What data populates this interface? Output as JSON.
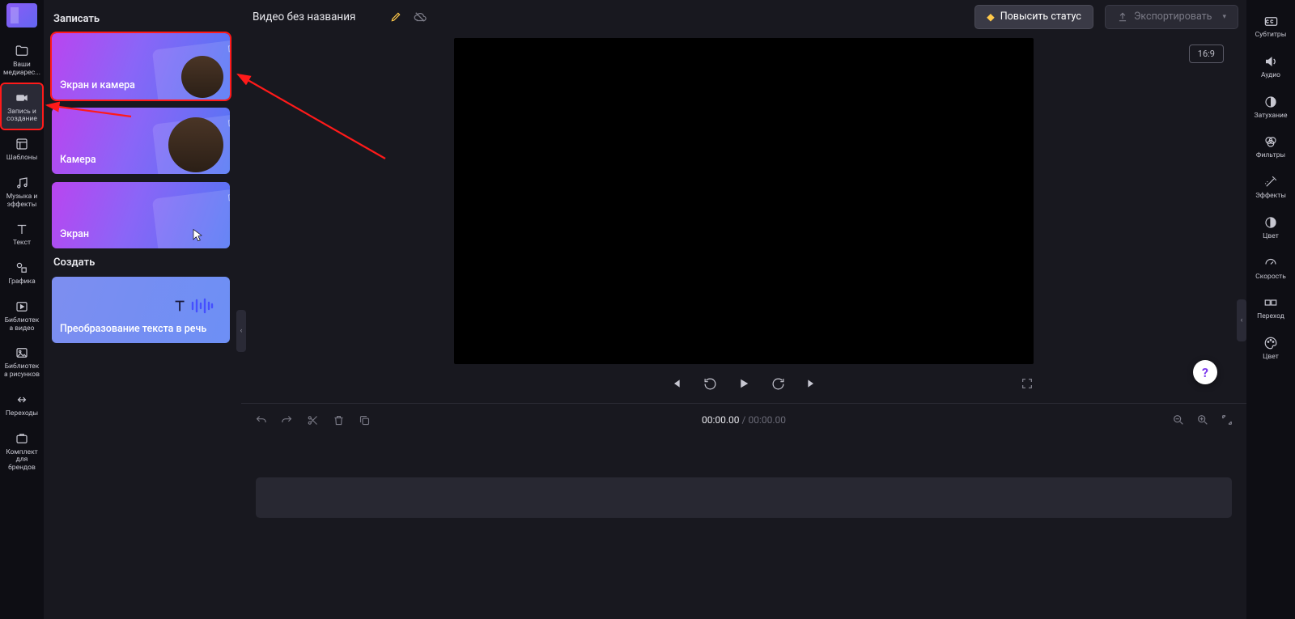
{
  "app": {
    "title": "Видео без названия"
  },
  "nav_left": [
    {
      "id": "media",
      "label": "Ваши медиарес..."
    },
    {
      "id": "record",
      "label": "Запись и создание"
    },
    {
      "id": "templates",
      "label": "Шаблоны"
    },
    {
      "id": "music",
      "label": "Музыка и эффекты"
    },
    {
      "id": "text",
      "label": "Текст"
    },
    {
      "id": "graphics",
      "label": "Графика"
    },
    {
      "id": "videolib",
      "label": "Библиотека видео"
    },
    {
      "id": "imagelib",
      "label": "Библиотека рисунков"
    },
    {
      "id": "transitions",
      "label": "Переходы"
    },
    {
      "id": "brandkit",
      "label": "Комплект для брендов"
    }
  ],
  "panel": {
    "section_record": "Записать",
    "section_create": "Создать",
    "cards": {
      "screen_camera": "Экран и камера",
      "camera": "Камера",
      "screen": "Экран",
      "tts": "Преобразование текста в речь"
    }
  },
  "topbar": {
    "upgrade": "Повысить статус",
    "export": "Экспортировать"
  },
  "preview": {
    "aspect": "16:9"
  },
  "timecode": {
    "current": "00:00.00",
    "total": "00:00.00"
  },
  "nav_right": [
    {
      "id": "subtitles",
      "label": "Субтитры"
    },
    {
      "id": "audio",
      "label": "Аудио"
    },
    {
      "id": "fade",
      "label": "Затухание"
    },
    {
      "id": "filters",
      "label": "Фильтры"
    },
    {
      "id": "effects",
      "label": "Эффекты"
    },
    {
      "id": "color",
      "label": "Цвет"
    },
    {
      "id": "speed",
      "label": "Скорость"
    },
    {
      "id": "transition",
      "label": "Переход"
    },
    {
      "id": "color2",
      "label": "Цвет"
    }
  ],
  "help": "?"
}
